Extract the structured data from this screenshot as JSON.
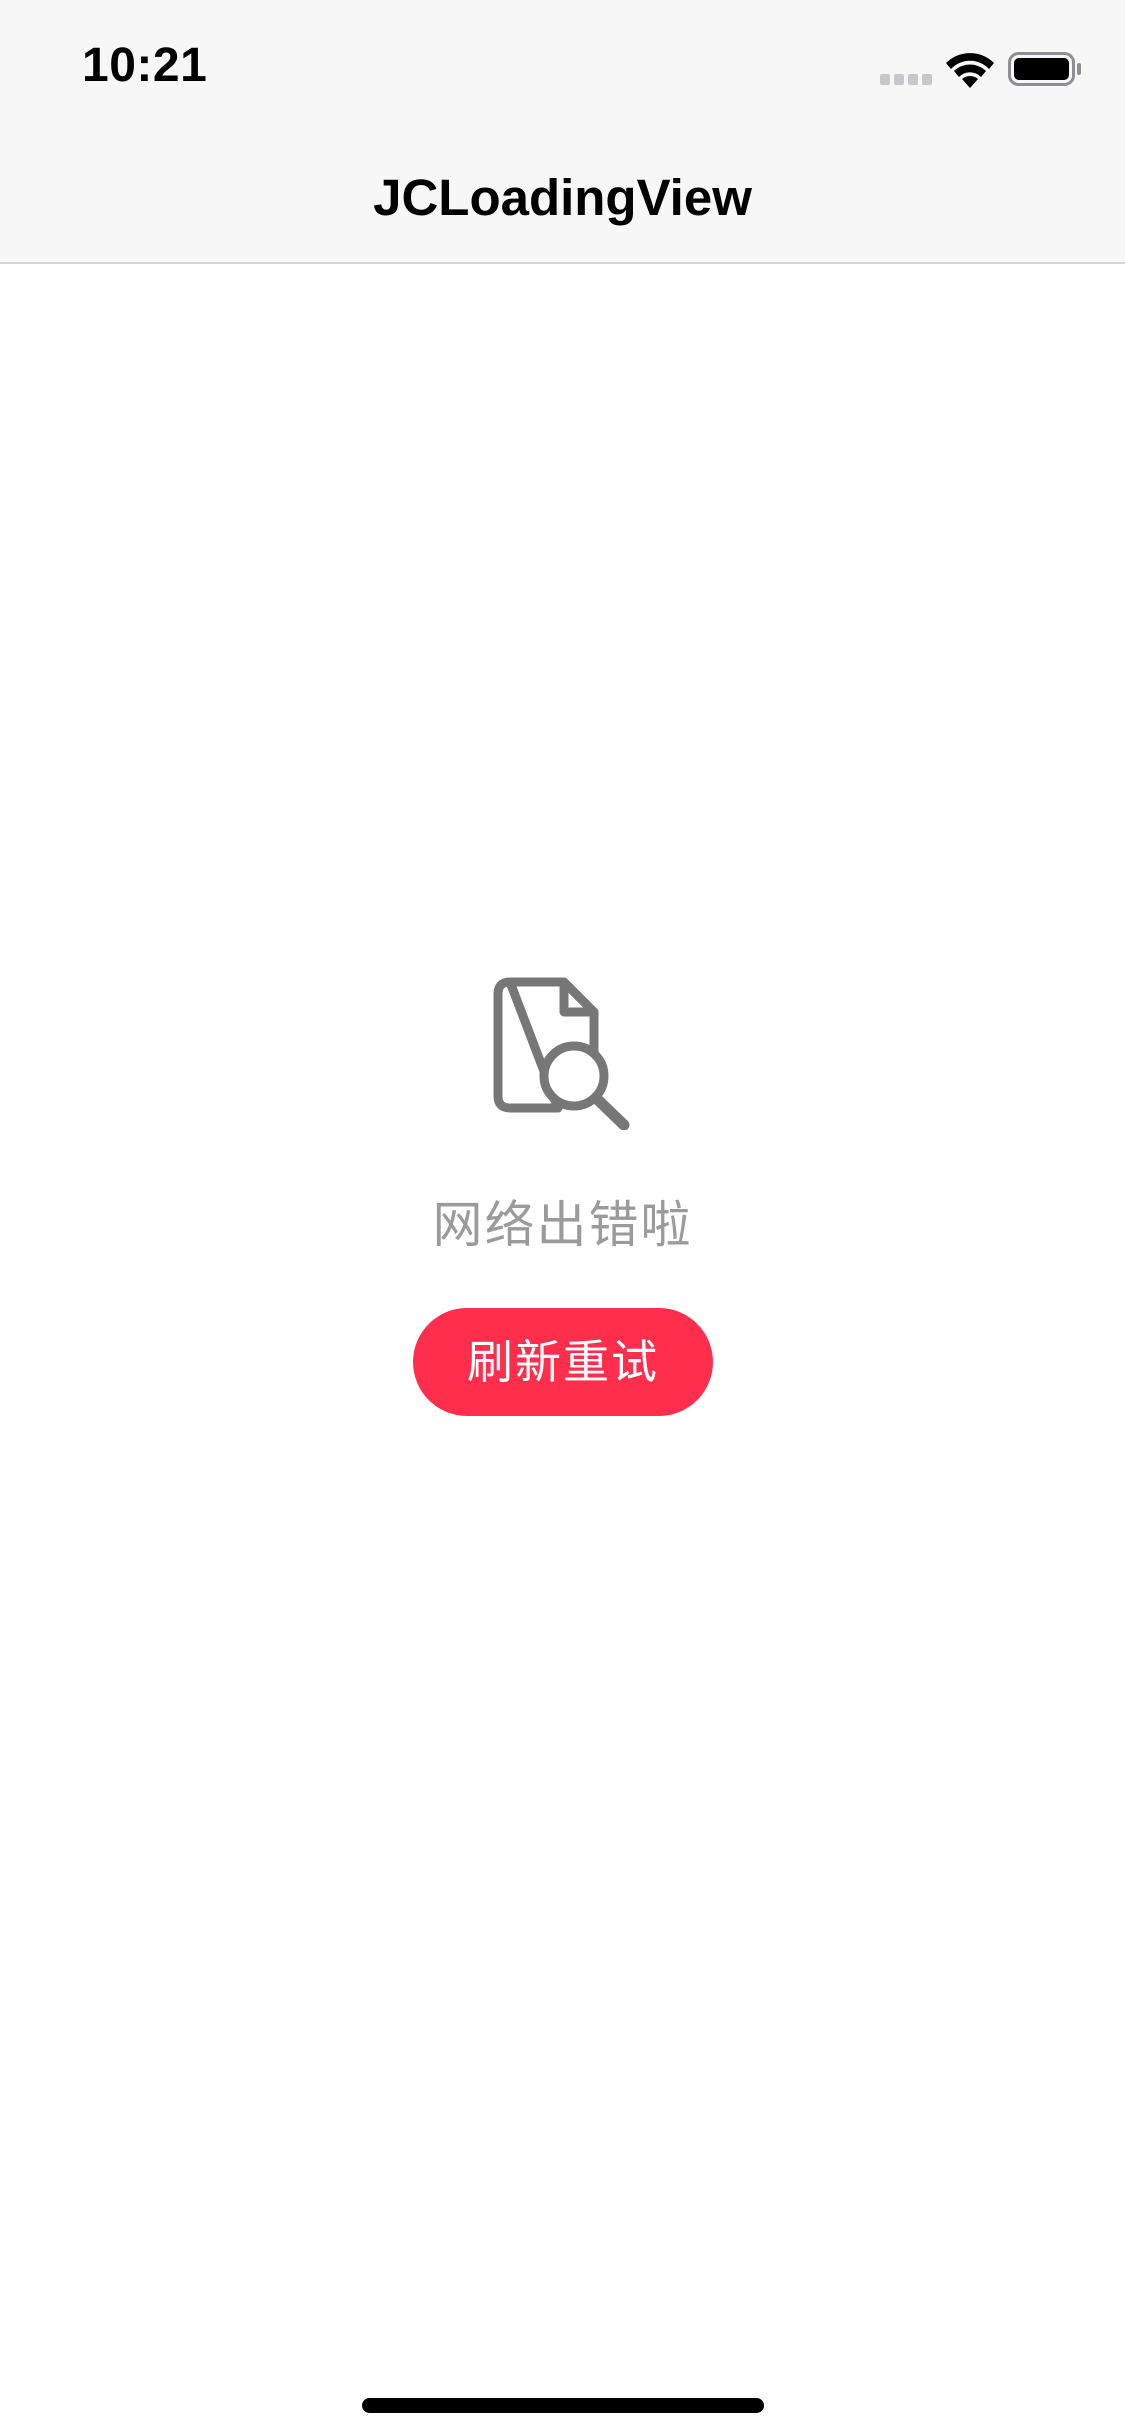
{
  "status_bar": {
    "time": "10:21"
  },
  "nav_bar": {
    "title": "JCLoadingView"
  },
  "empty_state": {
    "icon": "document-search-icon",
    "message": "网络出错啦",
    "retry_label": "刷新重试"
  },
  "colors": {
    "accent": "#ff2e4c",
    "message_text": "#9b9b9b",
    "icon_gray": "#777777",
    "nav_background": "#f7f7f7"
  }
}
